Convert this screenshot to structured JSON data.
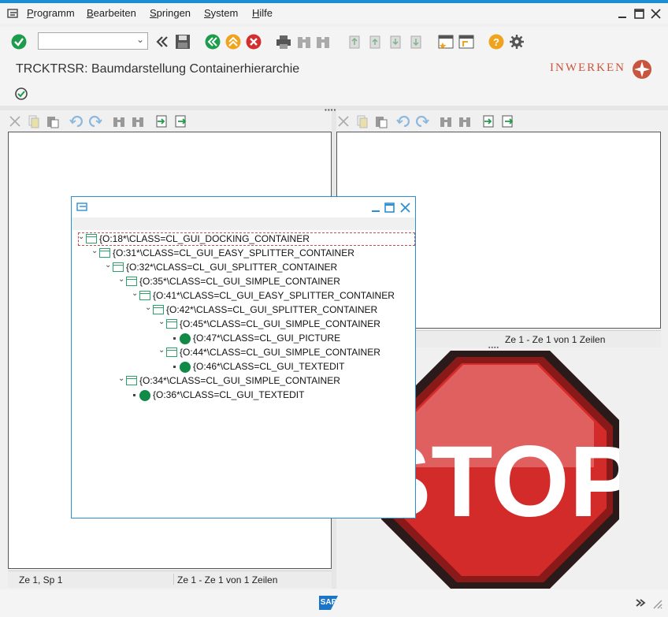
{
  "menubar": {
    "items": [
      {
        "accel": "P",
        "rest": "rogramm"
      },
      {
        "accel": "B",
        "rest": "earbeiten"
      },
      {
        "accel": "S",
        "rest": "pringen"
      },
      {
        "accel": "S",
        "rest": "ystem"
      },
      {
        "accel": "H",
        "rest": "ilfe"
      }
    ]
  },
  "toolbar": {
    "command_field_value": ""
  },
  "header": {
    "title": "TRCKTRSR: Baumdarstellung Containerhierarchie",
    "logo_text": "INWERKEN"
  },
  "left_pane": {
    "status_cursor": "Ze 1, Sp 1",
    "status_lines": "Ze 1 - Ze 1 von 1 Zeilen"
  },
  "right_pane": {
    "status_lines": "Ze 1 - Ze 1 von 1 Zeilen"
  },
  "stop_sign": {
    "text": "STOP"
  },
  "footer": {
    "sap_logo": "SAP"
  },
  "popup": {
    "tree": [
      {
        "level": 0,
        "type": "container",
        "label": "{O:18*\\CLASS=CL_GUI_DOCKING_CONTAINER"
      },
      {
        "level": 1,
        "type": "container",
        "label": "{O:31*\\CLASS=CL_GUI_EASY_SPLITTER_CONTAINER"
      },
      {
        "level": 2,
        "type": "container",
        "label": "{O:32*\\CLASS=CL_GUI_SPLITTER_CONTAINER"
      },
      {
        "level": 3,
        "type": "container",
        "label": "{O:35*\\CLASS=CL_GUI_SIMPLE_CONTAINER"
      },
      {
        "level": 4,
        "type": "container",
        "label": "{O:41*\\CLASS=CL_GUI_EASY_SPLITTER_CONTAINER"
      },
      {
        "level": 5,
        "type": "container",
        "label": "{O:42*\\CLASS=CL_GUI_SPLITTER_CONTAINER"
      },
      {
        "level": 6,
        "type": "container",
        "label": "{O:45*\\CLASS=CL_GUI_SIMPLE_CONTAINER"
      },
      {
        "level": 7,
        "type": "leaf",
        "label": "{O:47*\\CLASS=CL_GUI_PICTURE"
      },
      {
        "level": 6,
        "type": "container",
        "label": "{O:44*\\CLASS=CL_GUI_SIMPLE_CONTAINER"
      },
      {
        "level": 7,
        "type": "leaf",
        "label": "{O:46*\\CLASS=CL_GUI_TEXTEDIT"
      },
      {
        "level": 3,
        "type": "container",
        "label": "{O:34*\\CLASS=CL_GUI_SIMPLE_CONTAINER"
      },
      {
        "level": 4,
        "type": "leaf",
        "label": "{O:36*\\CLASS=CL_GUI_TEXTEDIT"
      }
    ]
  },
  "colors": {
    "accent": "#1b8fd1",
    "stop_red": "#d42a2a",
    "stop_light": "#e35c5c",
    "leaf_green": "#128a47"
  }
}
